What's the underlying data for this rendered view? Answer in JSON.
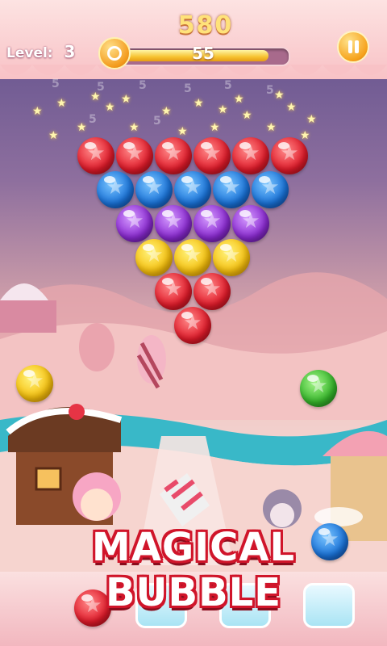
{
  "hud": {
    "level_label": "Level:",
    "level_value": "3",
    "score": "580",
    "timer_value": "55",
    "timer_fill_fraction": 0.9
  },
  "ghost_numbers": [
    "5",
    "5",
    "5",
    "5",
    "5",
    "5",
    "5",
    "5"
  ],
  "grid": {
    "rows": [
      [
        "red",
        "red",
        "red",
        "red",
        "red",
        "red"
      ],
      [
        "blue",
        "blue",
        "blue",
        "blue",
        "blue"
      ],
      [
        "purple",
        "purple",
        "purple",
        "purple"
      ],
      [
        "yellow",
        "yellow",
        "yellow"
      ],
      [
        "red",
        "red"
      ],
      [
        "red"
      ]
    ]
  },
  "side_bubbles": {
    "left": "yellow",
    "right": "green"
  },
  "shooter": {
    "current": "red",
    "next": "blue"
  },
  "banner": {
    "title": "MAGICAL BUBBLE"
  }
}
